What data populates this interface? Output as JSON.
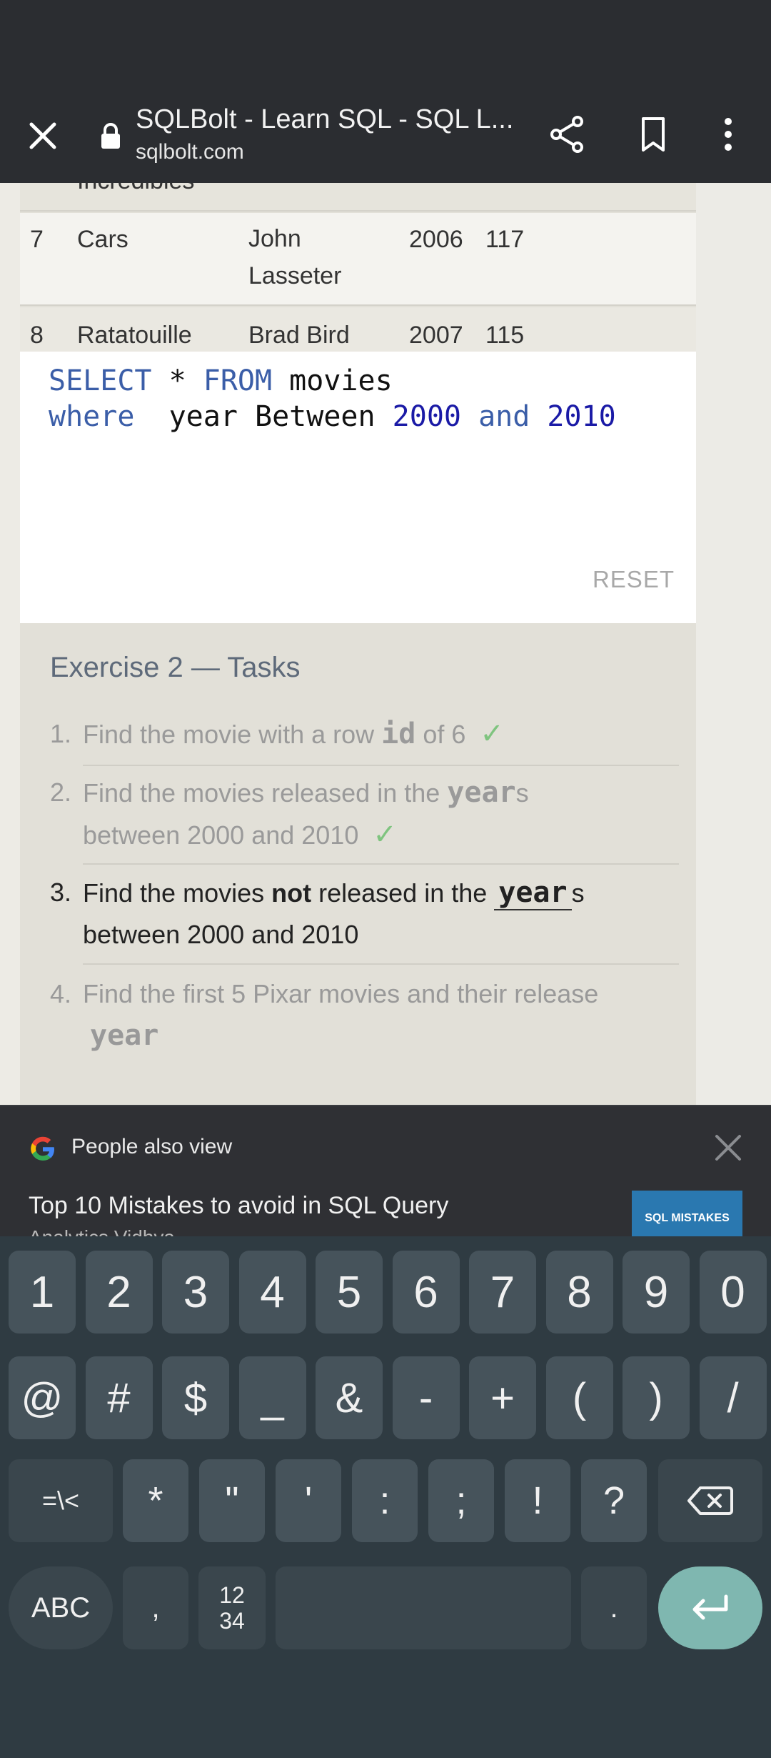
{
  "browser": {
    "title": "SQLBolt - Learn SQL - SQL L...",
    "url": "sqlbolt.com"
  },
  "table": {
    "partial_row": {
      "title": "Incredibles"
    },
    "rows": [
      {
        "id": "7",
        "title": "Cars",
        "director_line1": "John",
        "director_line2": "Lasseter",
        "year": "2006",
        "length": "117"
      },
      {
        "id": "8",
        "title": "Ratatouille",
        "director_line1": "Brad Bird",
        "year": "2007",
        "length": "115"
      }
    ]
  },
  "editor": {
    "line1": {
      "kw1": "SELECT",
      "star": " * ",
      "kw2": "FROM",
      "rest": " movies"
    },
    "line2": {
      "kw1": "where",
      "mid": "  year Between ",
      "n1": "2000",
      "and": " and ",
      "n2": "2010"
    },
    "reset_label": "RESET"
  },
  "exercise": {
    "title": "Exercise 2 — Tasks",
    "tasks": [
      {
        "num": "1.",
        "text_a": "Find the movie with a row ",
        "code": "id",
        "text_b": " of 6",
        "check": "✓"
      },
      {
        "num": "2.",
        "text_a": "Find the movies released in the ",
        "code": "year",
        "text_b": "s",
        "line2": "between 2000 and 2010",
        "check": "✓"
      },
      {
        "num": "3.",
        "text_a": "Find the movies ",
        "bold": "not",
        "text_a2": " released in the ",
        "code": "year",
        "text_b": "s",
        "line2": "between 2000 and 2010"
      },
      {
        "num": "4.",
        "text_a": "Find the first 5 Pixar movies and their release",
        "code": "year"
      }
    ]
  },
  "people_also_view": {
    "heading": "People also view",
    "link": "Top 10 Mistakes to avoid in SQL Query",
    "source": "Analytics Vidhya",
    "thumb_text": "SQL MISTAKES"
  },
  "keyboard": {
    "row1": [
      "1",
      "2",
      "3",
      "4",
      "5",
      "6",
      "7",
      "8",
      "9",
      "0"
    ],
    "row2": [
      "@",
      "#",
      "$",
      "_",
      "&",
      "-",
      "+",
      "(",
      ")",
      "/"
    ],
    "row3": [
      "=\\<",
      "*",
      "\"",
      "'",
      ":",
      ";",
      "!",
      "?"
    ],
    "abc": "ABC",
    "comma": ",",
    "numpad": "12\n34",
    "period": "."
  }
}
